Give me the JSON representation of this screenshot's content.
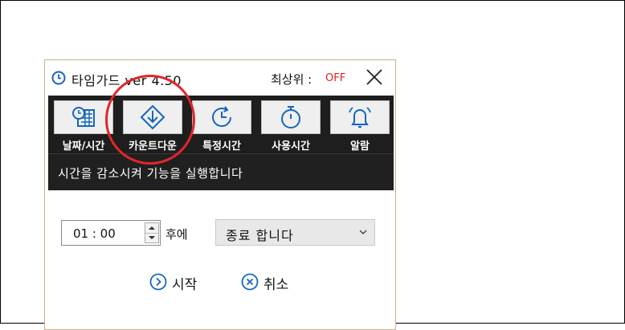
{
  "window": {
    "title": "타임가드 ver 4.50",
    "topmost_label": "최상위 :",
    "topmost_value": "OFF"
  },
  "toolbar": {
    "tools": [
      {
        "label": "날짜/시간",
        "icon": "calendar-clock-icon"
      },
      {
        "label": "카운트다운",
        "icon": "countdown-arrow-icon"
      },
      {
        "label": "특정시간",
        "icon": "clock-refresh-icon"
      },
      {
        "label": "사용시간",
        "icon": "stopwatch-icon"
      },
      {
        "label": "알람",
        "icon": "bell-icon"
      }
    ]
  },
  "description": "시간을 감소시켜 기능을 실행합니다",
  "form": {
    "time_value": "01 : 00",
    "after_label": "후에",
    "action_select": "종료 합니다"
  },
  "actions": {
    "start_label": "시작",
    "cancel_label": "취소"
  },
  "colors": {
    "toolbar_bg": "#1e1e1e",
    "accent_blue": "#1565c0",
    "off_red": "#e02020",
    "highlight_red": "#e2262b"
  }
}
